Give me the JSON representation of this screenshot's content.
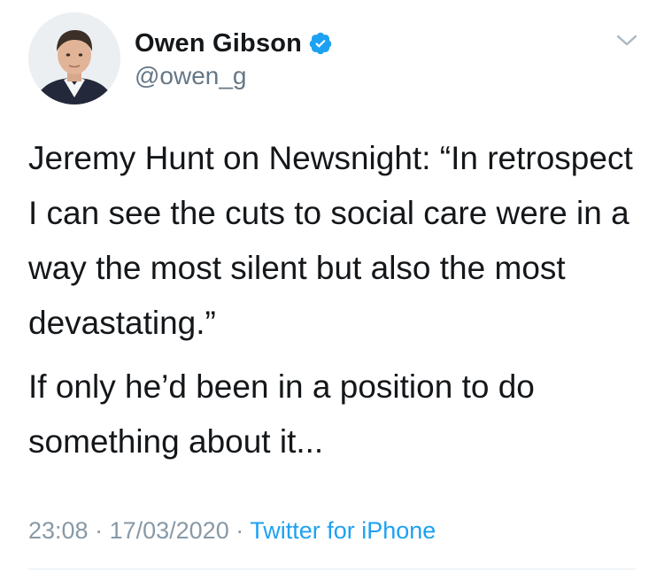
{
  "author": {
    "display_name": "Owen Gibson",
    "handle": "@owen_g",
    "verified": true
  },
  "tweet": {
    "paragraphs": [
      "Jeremy Hunt on Newsnight: “In retrospect I can see the cuts to social care were in a way the most silent but also the most devastating.”",
      "If only he’d been in a position to do something about it..."
    ]
  },
  "meta": {
    "time": "23:08",
    "dot1": " · ",
    "date": "17/03/2020",
    "dot2": " · ",
    "source": "Twitter for iPhone"
  },
  "colors": {
    "text": "#14171a",
    "secondary": "#657786",
    "link": "#1da1f2",
    "verified": "#1da1f2"
  },
  "icons": {
    "verified": "verified-badge-icon",
    "menu": "chevron-down-icon"
  }
}
